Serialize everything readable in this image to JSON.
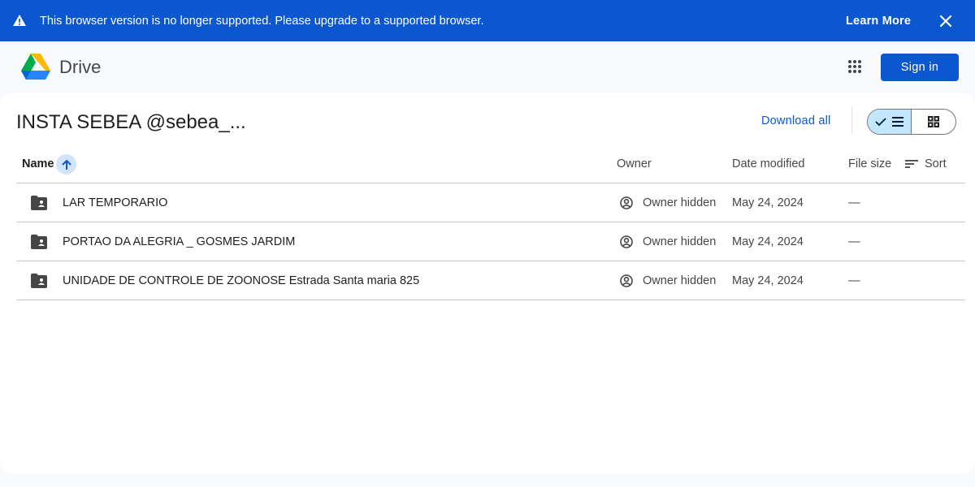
{
  "banner": {
    "message": "This browser version is no longer supported. Please upgrade to a supported browser.",
    "learn_more": "Learn More",
    "close_icon": "close-icon",
    "warning_icon": "warning-icon",
    "background": "#0b57d0"
  },
  "topbar": {
    "brand": "Drive",
    "apps_icon": "apps-grid-icon",
    "sign_in": "Sign in"
  },
  "folder": {
    "title": "INSTA SEBEA @sebea_...",
    "download_all": "Download all",
    "view_modes": [
      "list-view",
      "grid-view"
    ],
    "active_view": "list-view"
  },
  "table": {
    "headers": {
      "name": "Name",
      "owner": "Owner",
      "date_modified": "Date modified",
      "file_size": "File size",
      "sort": "Sort"
    },
    "sorted_by": "name",
    "sort_direction": "ascending",
    "rows": [
      {
        "name": "LAR TEMPORARIO",
        "owner": "Owner hidden",
        "date": "May 24, 2024",
        "size": "—"
      },
      {
        "name": "PORTAO DA ALEGRIA _ GOSMES JARDIM",
        "owner": "Owner hidden",
        "date": "May 24, 2024",
        "size": "—"
      },
      {
        "name": "UNIDADE DE CONTROLE DE ZOONOSE Estrada Santa maria 825",
        "owner": "Owner hidden",
        "date": "May 24, 2024",
        "size": "—"
      }
    ]
  },
  "colors": {
    "accent": "#0b57d0",
    "active_toggle": "#c2e7ff",
    "sort_chip": "#d3e3fd"
  }
}
